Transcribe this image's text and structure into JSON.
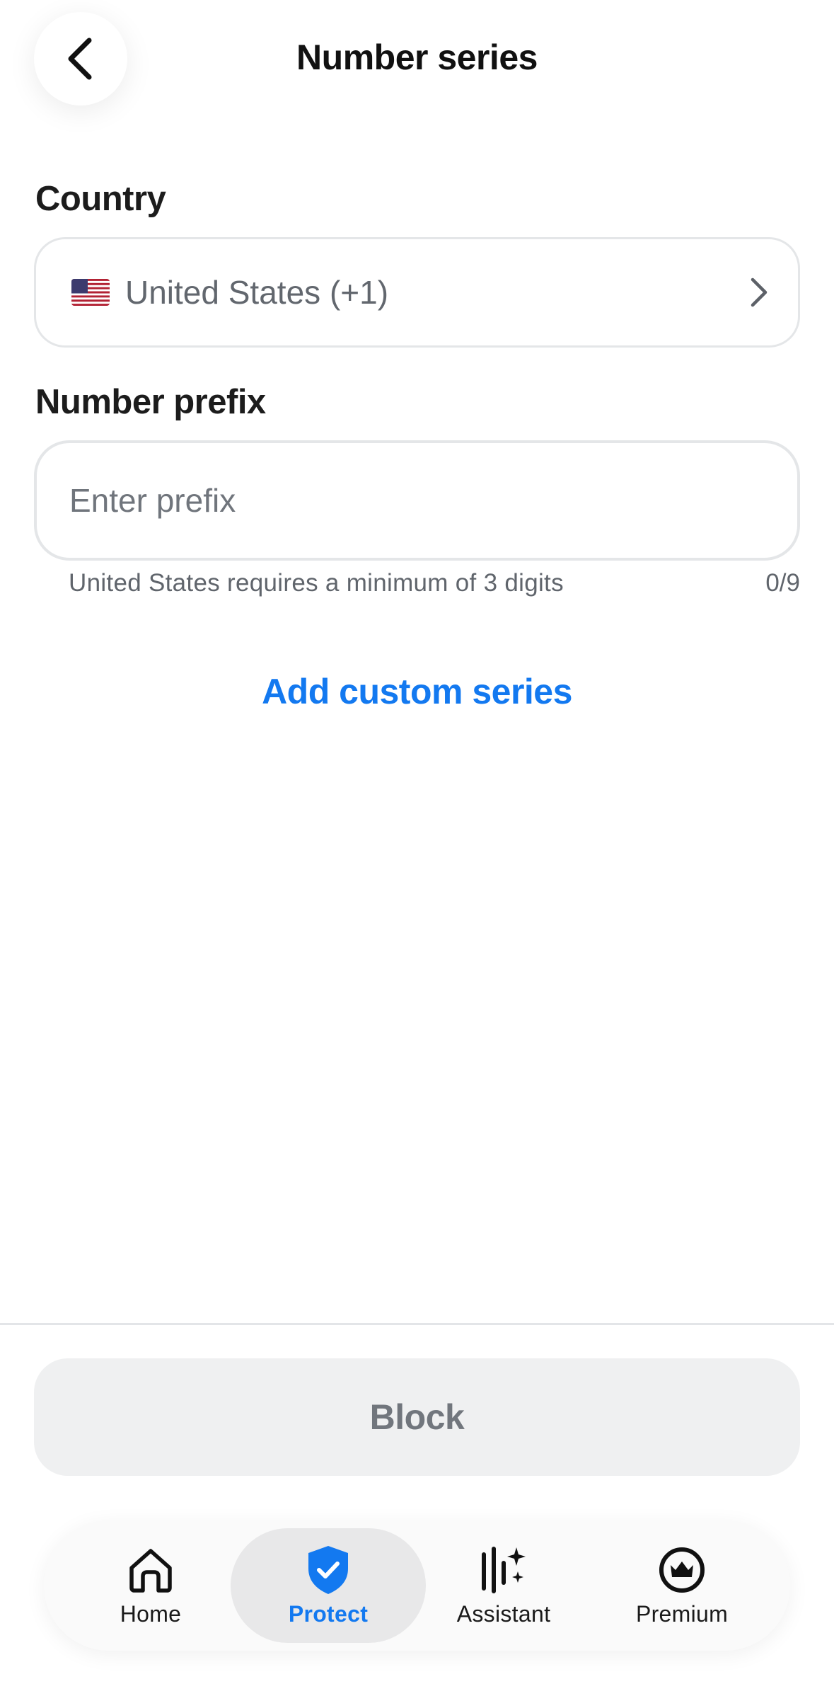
{
  "header": {
    "title": "Number series",
    "back_icon": "chevron-left-icon"
  },
  "country": {
    "label": "Country",
    "flag": "us-flag-icon",
    "value": "United States (+1)",
    "chevron": "chevron-right-icon"
  },
  "prefix": {
    "label": "Number prefix",
    "placeholder": "Enter prefix",
    "value": "",
    "hint": "United States requires a minimum of 3 digits",
    "counter": "0/9"
  },
  "add_custom_series": "Add custom series",
  "block_button": "Block",
  "nav": {
    "items": [
      {
        "label": "Home",
        "icon": "home-icon",
        "active": false
      },
      {
        "label": "Protect",
        "icon": "shield-check-icon",
        "active": true
      },
      {
        "label": "Assistant",
        "icon": "assistant-sparkle-icon",
        "active": false
      },
      {
        "label": "Premium",
        "icon": "crown-icon",
        "active": false
      }
    ]
  },
  "colors": {
    "accent": "#1379f0",
    "muted_text": "#62676e",
    "border": "#e4e6e8",
    "disabled_bg": "#eff0f1"
  }
}
